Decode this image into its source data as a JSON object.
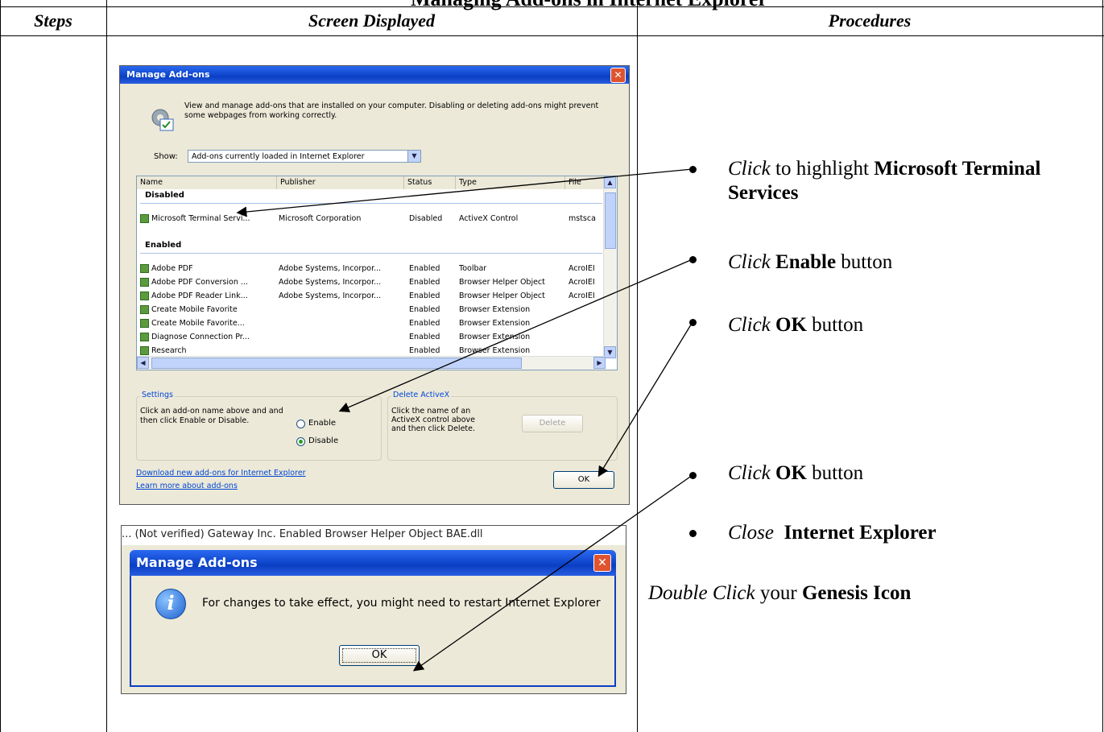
{
  "page_title": "Managing Add-ons in Internet Explorer",
  "table": {
    "headers": [
      "Steps",
      "Screen Displayed",
      "Procedures"
    ]
  },
  "dialog1": {
    "title": "Manage Add-ons",
    "description": "View and manage add-ons that are installed on your computer. Disabling or deleting add-ons might prevent some webpages from working correctly.",
    "show_label": "Show:",
    "show_value": "Add-ons currently loaded in Internet Explorer",
    "columns": [
      "Name",
      "Publisher",
      "Status",
      "Type",
      "File"
    ],
    "group_disabled": "Disabled",
    "group_enabled": "Enabled",
    "rows_disabled": [
      {
        "name": "Microsoft Terminal Servi...",
        "publisher": "Microsoft Corporation",
        "status": "Disabled",
        "type": "ActiveX Control",
        "file": "mstsca"
      }
    ],
    "rows_enabled": [
      {
        "name": "Adobe PDF",
        "publisher": "Adobe Systems, Incorpor...",
        "status": "Enabled",
        "type": "Toolbar",
        "file": "AcroIEI"
      },
      {
        "name": "Adobe PDF Conversion ...",
        "publisher": "Adobe Systems, Incorpor...",
        "status": "Enabled",
        "type": "Browser Helper Object",
        "file": "AcroIEI"
      },
      {
        "name": "Adobe PDF Reader Link...",
        "publisher": "Adobe Systems, Incorpor...",
        "status": "Enabled",
        "type": "Browser Helper Object",
        "file": "AcroIEI"
      },
      {
        "name": "Create Mobile Favorite",
        "publisher": "",
        "status": "Enabled",
        "type": "Browser Extension",
        "file": ""
      },
      {
        "name": "Create Mobile Favorite...",
        "publisher": "",
        "status": "Enabled",
        "type": "Browser Extension",
        "file": ""
      },
      {
        "name": "Diagnose Connection Pr...",
        "publisher": "",
        "status": "Enabled",
        "type": "Browser Extension",
        "file": ""
      },
      {
        "name": "Research",
        "publisher": "",
        "status": "Enabled",
        "type": "Browser Extension",
        "file": ""
      }
    ],
    "settings_label": "Settings",
    "settings_text": "Click an add-on name above and and then click Enable or Disable.",
    "radio_enable": "Enable",
    "radio_disable": "Disable",
    "delete_label": "Delete ActiveX",
    "delete_text": "Click the name of an ActiveX control above and then click Delete.",
    "delete_button": "Delete",
    "link_download": "Download new add-ons for Internet Explorer",
    "link_learn": "Learn more about add-ons",
    "ok_button": "OK"
  },
  "dialog2": {
    "peek_text": "... (Not verified) Gateway Inc.     Enabled      Browser Helper Object   BAE.dll",
    "title": "Manage Add-ons",
    "message": "For changes to take effect, you might need to restart Internet Explorer",
    "ok_button": "OK"
  },
  "procedures": {
    "p1_verb": "Click",
    "p1_mid": " to highlight ",
    "p1_bold": "Microsoft Terminal Services",
    "p2_verb": "Click",
    "p2_bold": "Enable",
    "p2_end": " button",
    "p3_verb": "Click",
    "p3_bold": "OK",
    "p3_end": " button",
    "p4_verb": "Click",
    "p4_bold": "OK",
    "p4_end": " button",
    "p5_verb": "Close",
    "p5_bold": "Internet Explorer",
    "p6_verb": "Double Click",
    "p6_mid": " your ",
    "p6_bold": "Genesis Icon"
  }
}
